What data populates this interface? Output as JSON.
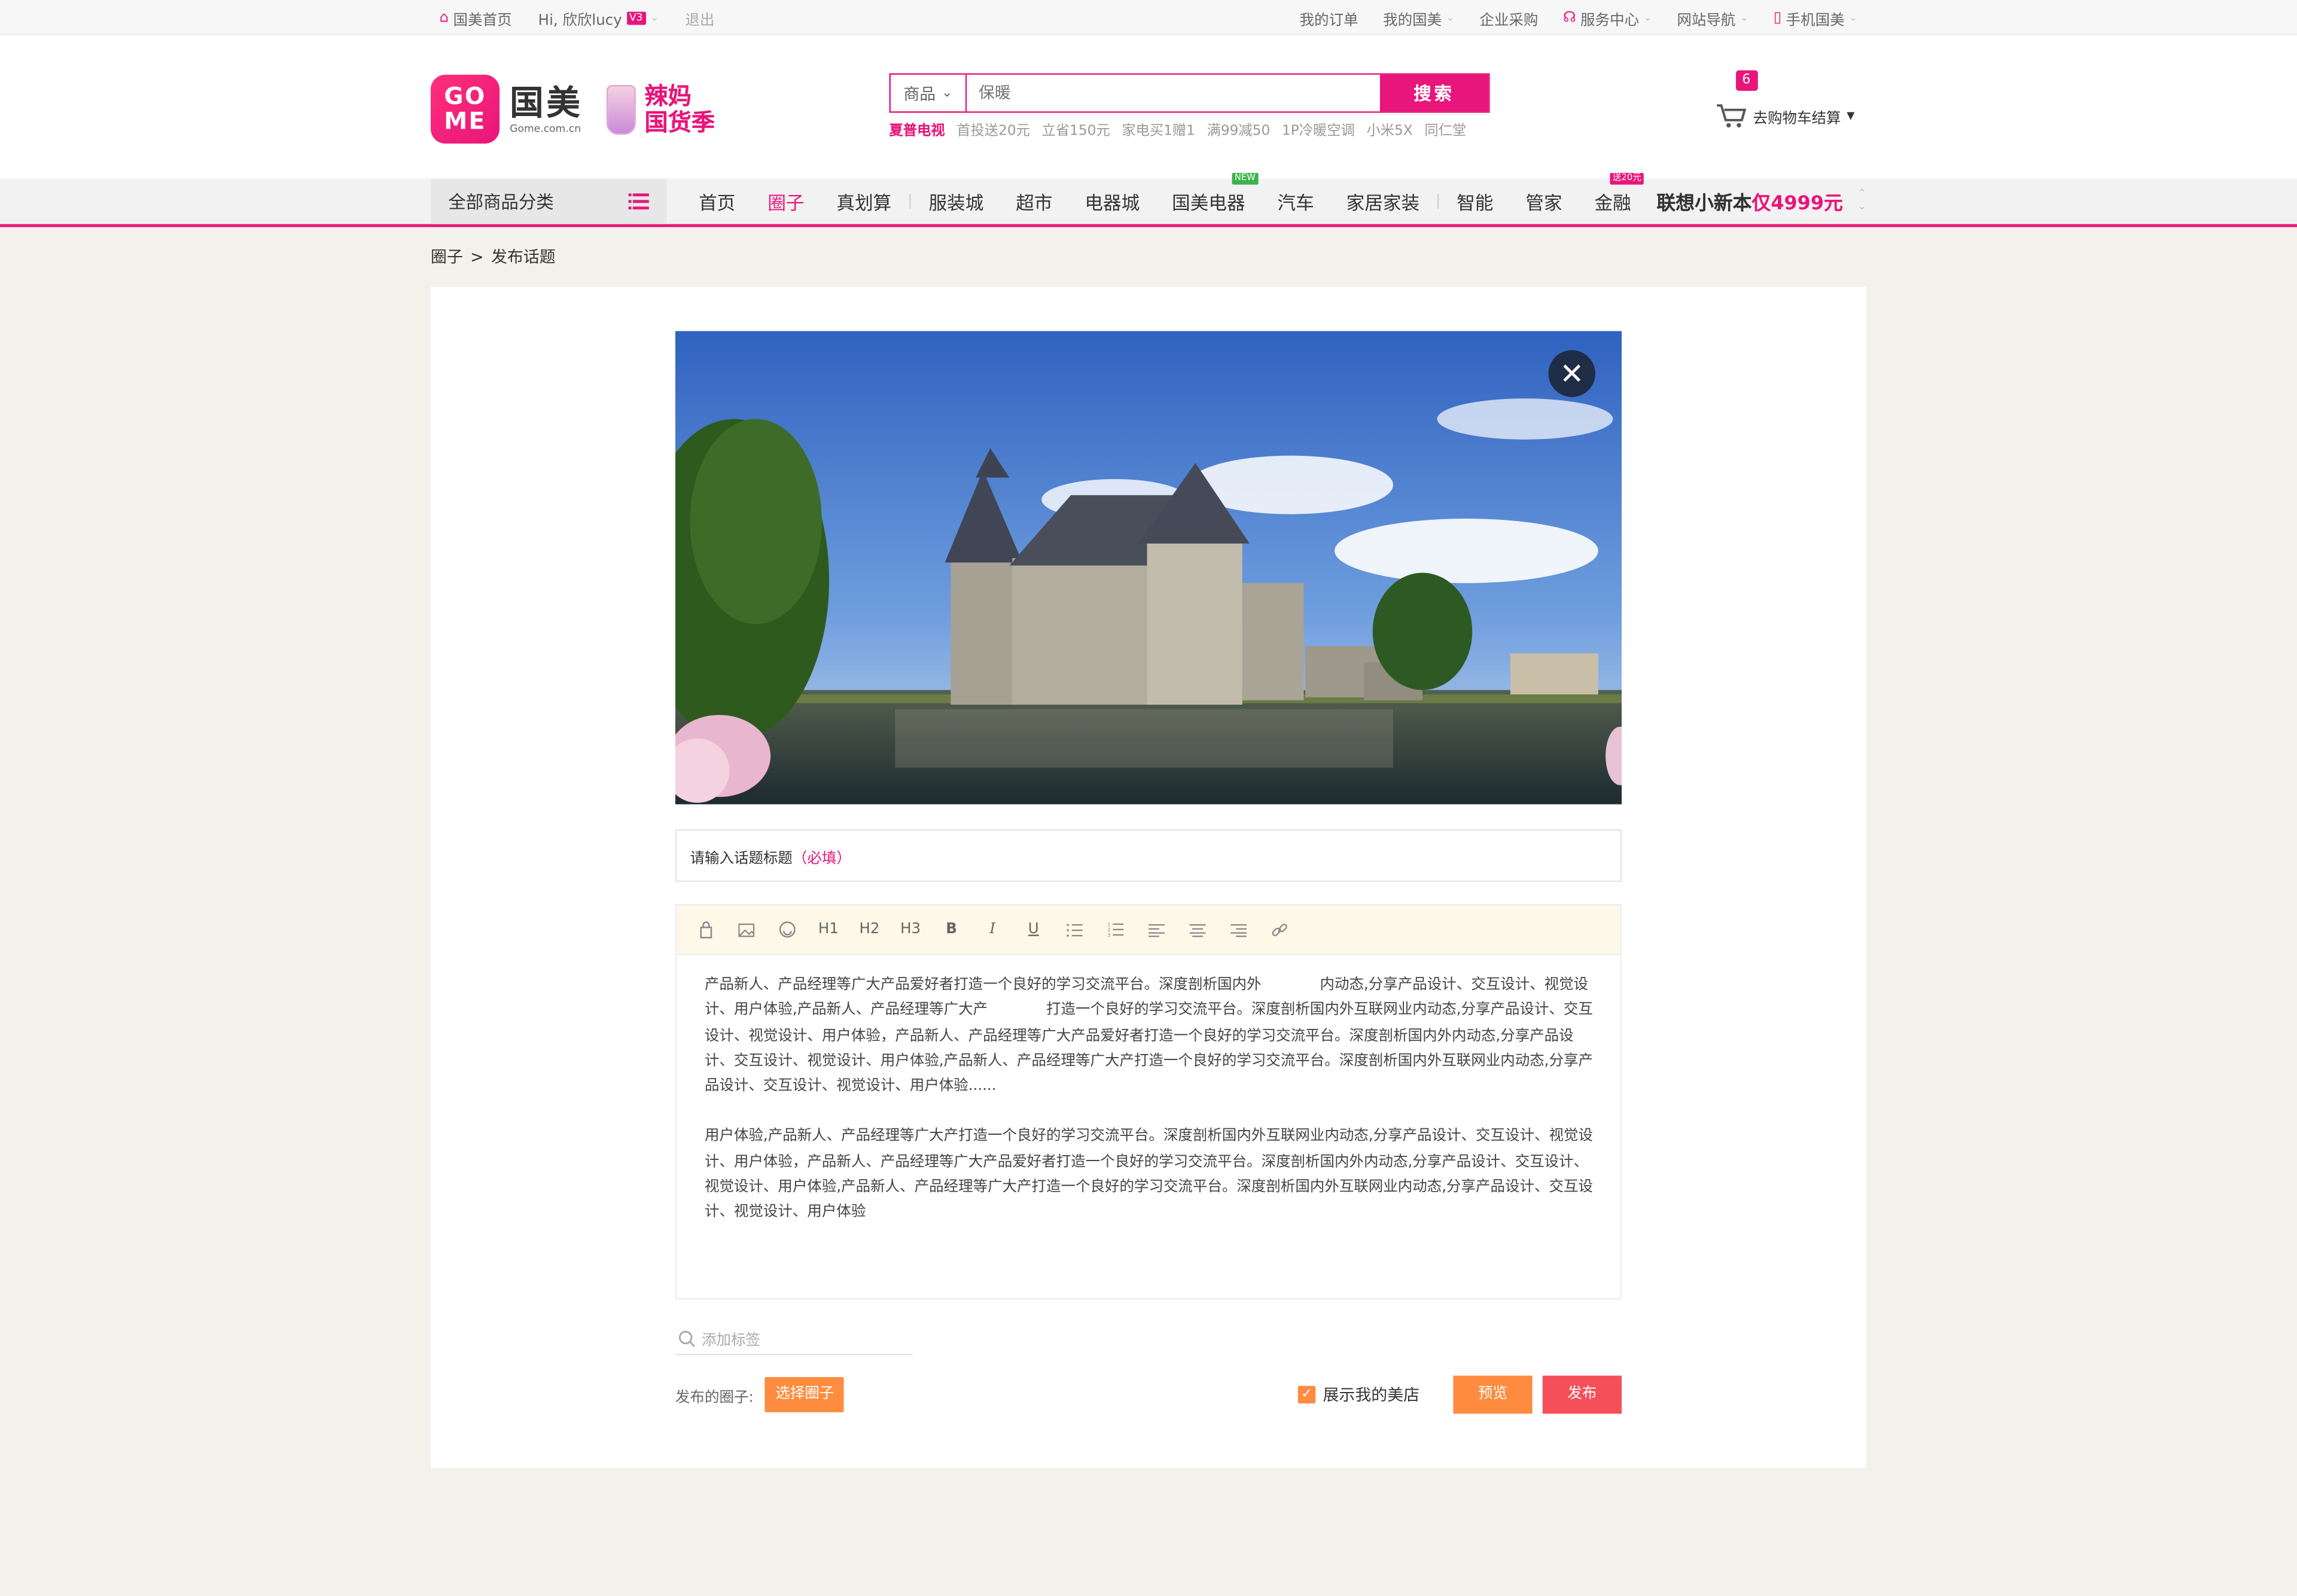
{
  "topbar": {
    "home": "国美首页",
    "greeting": "Hi, 欣欣lucy",
    "level": "V3",
    "logout": "退出",
    "right": [
      "我的订单",
      "我的国美",
      "企业采购",
      "服务中心",
      "网站导航",
      "手机国美"
    ]
  },
  "header": {
    "logo_letters_1": "GO",
    "logo_letters_2": "ME",
    "logo_cn": "国美",
    "logo_domain": "Gome.com.cn",
    "promo_line1": "辣妈",
    "promo_line2": "国货季",
    "search_category": "商品",
    "search_placeholder": "保暖",
    "search_button": "搜索",
    "hotwords": [
      "夏普电视",
      "首投送20元",
      "立省150元",
      "家电买1赠1",
      "满99减50",
      "1P冷暖空调",
      "小米5X",
      "同仁堂"
    ],
    "cart_count": "6",
    "cart_label": "去购物车结算"
  },
  "nav": {
    "all_categories": "全部商品分类",
    "items": [
      "首页",
      "圈子",
      "真划算",
      "服装城",
      "超市",
      "电器城",
      "国美电器",
      "汽车",
      "家居家装",
      "智能",
      "管家",
      "金融"
    ],
    "tag_new": "NEW",
    "tag_finance": "送20元",
    "ad_text": "联想小新本",
    "ad_price": "仅4999元"
  },
  "breadcrumb": {
    "root": "圈子",
    "separator": ">",
    "current": "发布话题"
  },
  "editor": {
    "title_placeholder": "请输入话题标题",
    "title_required": "（必填）",
    "toolbar": [
      "H1",
      "H2",
      "H3",
      "B",
      "I",
      "U"
    ],
    "paragraph1": "产品新人、产品经理等广大产品爱好者打造一个良好的学习交流平台。深度剖析国内外　　　　内动态,分享产品设计、交互设计、视觉设计、用户体验,产品新人、产品经理等广大产　　　　打造一个良好的学习交流平台。深度剖析国内外互联网业内动态,分享产品设计、交互设计、视觉设计、用户体验，产品新人、产品经理等广大产品爱好者打造一个良好的学习交流平台。深度剖析国内外内动态,分享产品设计、交互设计、视觉设计、用户体验,产品新人、产品经理等广大产打造一个良好的学习交流平台。深度剖析国内外互联网业内动态,分享产品设计、交互设计、视觉设计、用户体验......",
    "paragraph2": "用户体验,产品新人、产品经理等广大产打造一个良好的学习交流平台。深度剖析国内外互联网业内动态,分享产品设计、交互设计、视觉设计、用户体验，产品新人、产品经理等广大产品爱好者打造一个良好的学习交流平台。深度剖析国内外内动态,分享产品设计、交互设计、视觉设计、用户体验,产品新人、产品经理等广大产打造一个良好的学习交流平台。深度剖析国内外互联网业内动态,分享产品设计、交互设计、视觉设计、用户体验",
    "tag_placeholder": "添加标签",
    "circle_label": "发布的圈子:",
    "choose_circle": "选择圈子",
    "show_shop": "展示我的美店",
    "preview": "预览",
    "publish": "发布"
  },
  "colors": {
    "brand": "#e8157a",
    "orange": "#ff8c3f",
    "publish": "#f5505a",
    "toolbar_bg": "#fdf8e7",
    "page_bg": "#f2f1ea"
  }
}
